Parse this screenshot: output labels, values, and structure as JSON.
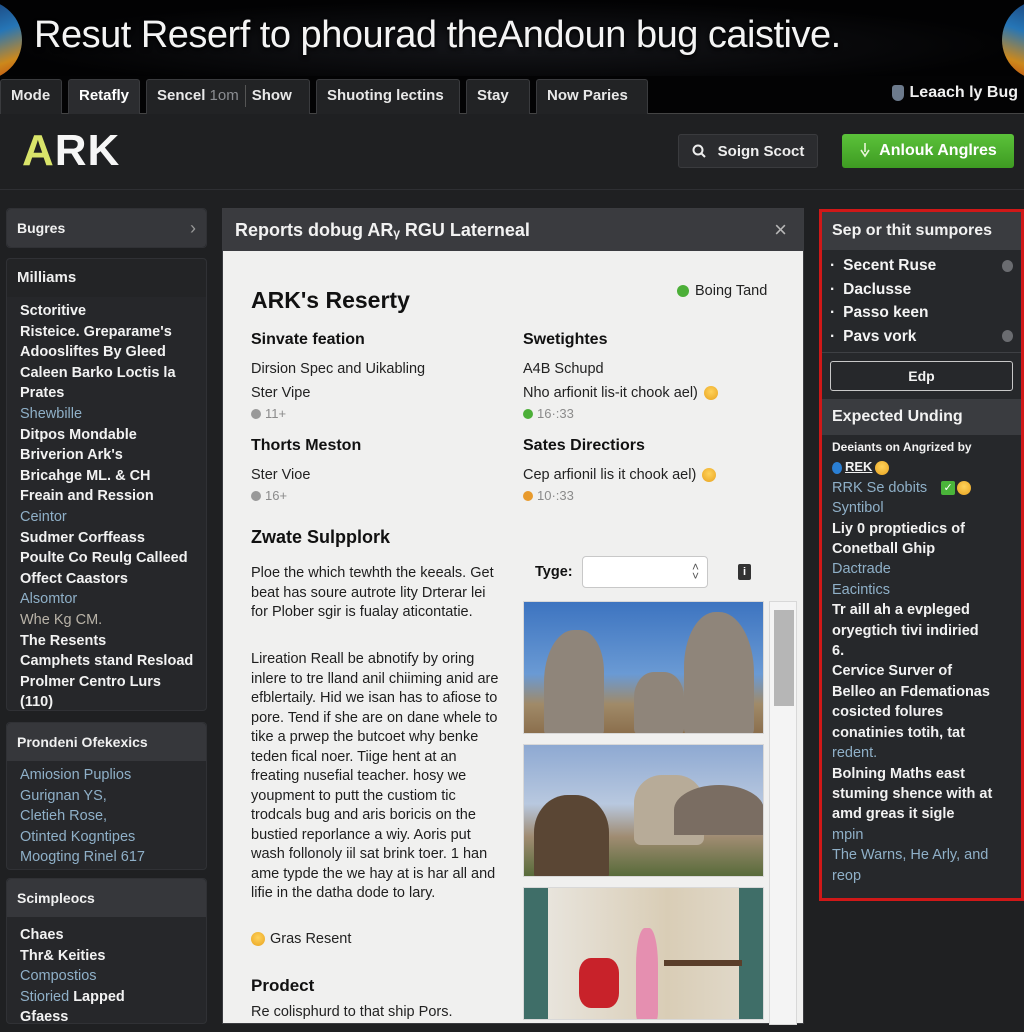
{
  "banner": {
    "title": "Resut Reserf to phourad theAndoun bug caistive."
  },
  "tabs": [
    {
      "label": "Mode",
      "active": false
    },
    {
      "label": "Retafly",
      "active": true
    },
    {
      "label_main": "Sencel",
      "label_dim": "1om",
      "label_extra": "Show",
      "active": false
    },
    {
      "label": "Shuoting lectins",
      "active": false
    },
    {
      "label": "Stay",
      "active": false
    },
    {
      "label": "Now Paries",
      "active": false
    }
  ],
  "tab_right": {
    "label": "Leaach ly Bug",
    "icon": "shield-icon"
  },
  "header": {
    "logo": {
      "first": "A",
      "rest": "RK"
    },
    "search_button": {
      "label": "Soign Scoct",
      "icon": "search-icon"
    },
    "action_button": {
      "label": "Anlouk Anglres",
      "icon": "pointer-icon",
      "color": "#4aaf2c"
    }
  },
  "sidebar": {
    "nav_header": {
      "label": "Bugres",
      "icon": "chevron-right-icon"
    },
    "section1": {
      "title": "Milliams",
      "items": [
        {
          "text": "Sctoritive",
          "style": "bold"
        },
        {
          "text": "Risteice. Greparame's",
          "style": "bold"
        },
        {
          "text": "Adoosliftes By Gleed",
          "style": "bold"
        },
        {
          "text": "Caleen Barko Loctis la",
          "style": "bold"
        },
        {
          "text": "Prates",
          "style": "bold"
        },
        {
          "text": "Shewbille",
          "style": "link"
        },
        {
          "text": "Ditpos Mondable",
          "style": "bold"
        },
        {
          "text": "Briverion Ark's",
          "style": "bold"
        },
        {
          "text": "Bricahge ML. & CH",
          "style": "bold"
        },
        {
          "text": "Freain and Ression",
          "style": "bold"
        },
        {
          "text": "Ceintor",
          "style": "link"
        },
        {
          "text": "Sudmer Corffeass",
          "style": "bold"
        },
        {
          "text": "Poulte Co Reulg Calleed",
          "style": "bold"
        },
        {
          "text": "Offect Caastors",
          "style": "bold"
        },
        {
          "text": "Alsomtor",
          "style": "link"
        },
        {
          "text": "Whe Kg CM.",
          "style": "muted"
        },
        {
          "text": "The Resents",
          "style": "bold"
        },
        {
          "text": "Camphets stand Resload",
          "style": "bold"
        },
        {
          "text": "Prolmer Centro Lurs",
          "style": "bold"
        },
        {
          "text": "(110)",
          "style": "bold"
        }
      ]
    },
    "section2": {
      "title": "Prondeni Ofekexics",
      "items": [
        {
          "text": "Amiosion Puplios",
          "style": "link"
        },
        {
          "text": "Gurignan YS,",
          "style": "link"
        },
        {
          "text": "Cletieh Rose,",
          "style": "link"
        },
        {
          "text": "Otinted Kogntipes",
          "style": "link"
        },
        {
          "text": "Moogting Rinel 617",
          "style": "link"
        }
      ]
    },
    "section3": {
      "title": "Scimpleocs",
      "items": [
        {
          "text": "Chaes",
          "style": "bold"
        },
        {
          "text": "Thr& Keities",
          "style": "bold"
        },
        {
          "text": "Compostios",
          "style": "link"
        },
        {
          "text": "Stioried",
          "style": "link",
          "suffix": "Lapped"
        },
        {
          "text": "Gfaess",
          "style": "bold"
        }
      ]
    }
  },
  "modal": {
    "title": "Reports dobug ARᵧ RGU Laterneal",
    "close_icon": "close-icon",
    "heading": "ARK's Reserty",
    "status": {
      "label": "Boing Tand",
      "color": "#4caf38"
    },
    "columns": [
      {
        "heading": "Sinvate feation",
        "line1": "Dirsion Spec and Uikabling",
        "line2": "Ster Vipe",
        "meta": "11+",
        "meta_icon": "clock-icon"
      },
      {
        "heading": "Swetightes",
        "line1": "A4B Schupd",
        "line2": "Nho arfionit lis-it chook ael)",
        "meta": "16·:33",
        "meta_icon": "green-dot-icon"
      },
      {
        "heading": "Thorts Meston",
        "line1": "Ster Vioe",
        "meta": "16+",
        "meta_icon": "clock-icon"
      },
      {
        "heading": "Sates Directiors",
        "line1": "Cep arfionil lis it chook ael)",
        "meta": "10·:33",
        "meta_icon": "orange-dot-icon"
      }
    ],
    "section_title": "Zwate Sulpplork",
    "paragraph1": "Ploe the which tewhth the keeals. Get beat has soure autrote lity Drterar lei for Plober sgir is fualay aticontatie.",
    "paragraph2": "Lireation Reall be abnotify by oring inlere to tre lland anil chiiming anid are efblertaily. Hid we isan has to afiose to pore. Tend if she are on dane whele to tike a prwep the butcoet why benke teden fical noer. Tiige hent at an freating nusefial teacher. hosy we youpment to putt the custiom tic trodcals bug and aris boricis on the bustied reporlance a wiy. Aoris put wash follonoly iil sat brink toer. 1 han ame typde the we hay at is har all and lifie in the datha dode to lary.",
    "reaction": "Gras Resent",
    "product_title": "Prodect",
    "product_text": "Re colisphurd to that ship Pors.",
    "type_label": "Tyge:",
    "type_value": "",
    "images": [
      {
        "alt": "Dinosaur statues under blue sky"
      },
      {
        "alt": "Man with dinosaur sculpture and mountain"
      },
      {
        "alt": "Woman in room with red scooter"
      }
    ],
    "scroll_position": 0.0
  },
  "right_panel": {
    "title": "Sep or thit sumpores",
    "items": [
      {
        "text": "Secent Ruse",
        "icon": "lock-icon"
      },
      {
        "text": "Daclusse",
        "icon": ""
      },
      {
        "text": "Passo keen",
        "icon": ""
      },
      {
        "text": "Pavs vork",
        "icon": "smile-icon"
      }
    ],
    "edit_button": "Edp",
    "section_title": "Expected Unding",
    "body": [
      {
        "text": "Deeiants on Angrized by",
        "style": "small"
      },
      {
        "text": "REK",
        "style": "badge"
      },
      {
        "text": "RRK Se dobits",
        "style": "link",
        "check": true
      },
      {
        "text": "Syntibol",
        "style": "link"
      },
      {
        "text": "Liy 0 proptiedics of",
        "style": "bold"
      },
      {
        "text": "Conetball Ghip",
        "style": "bold"
      },
      {
        "text": "Dactrade",
        "style": "link"
      },
      {
        "text": "Eacintics",
        "style": "link"
      },
      {
        "text": "Tr aill ah a evpleged",
        "style": "bold"
      },
      {
        "text": "oryegtich tivi indiried",
        "style": "bold"
      },
      {
        "text": "6.",
        "style": "bold"
      },
      {
        "text": "Cervice Surver of",
        "style": "bold"
      },
      {
        "text": "Belleo an Fdemationas",
        "style": "bold"
      },
      {
        "text": "cosicted folures",
        "style": "bold"
      },
      {
        "text": "conatinies totih, tat",
        "style": "bold"
      },
      {
        "text": "redent.",
        "style": "link"
      },
      {
        "text": "Bolning Maths east",
        "style": "bold"
      },
      {
        "text": "stuming shence with at",
        "style": "bold"
      },
      {
        "text": "amd greas it sigle",
        "style": "bold"
      },
      {
        "text": "mpin",
        "style": "link"
      },
      {
        "text": "The Warns, He Arly, and",
        "style": "link"
      },
      {
        "text": "reop",
        "style": "link"
      }
    ],
    "border_color": "#d01818"
  }
}
